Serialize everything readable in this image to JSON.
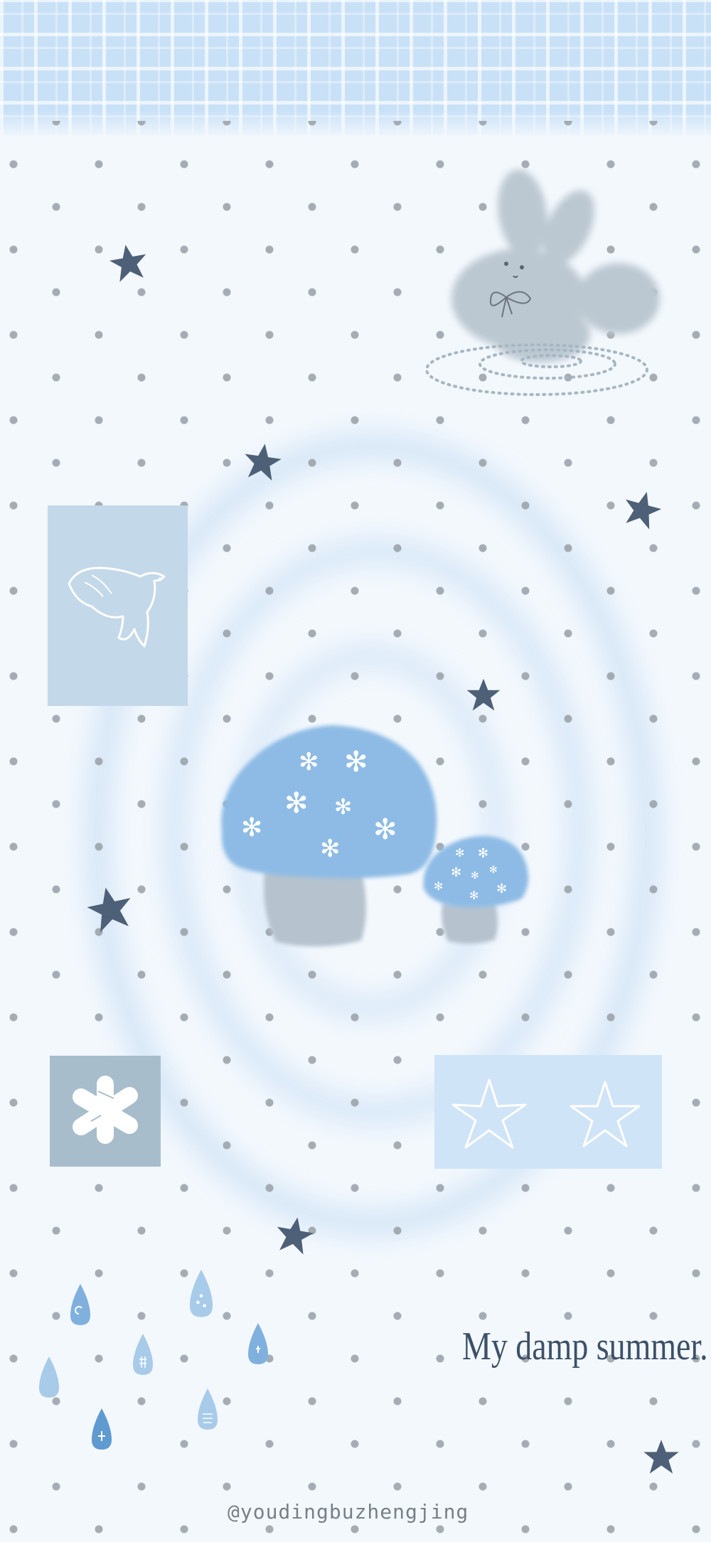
{
  "caption": "My damp summer.",
  "watermark": "@youdingbuzhengjing",
  "colors": {
    "background": "#f3f8fd",
    "plaid": "#c9e1f7",
    "polka_dot": "#9da4ab",
    "dark_star": "#4d6077",
    "mushroom_cap": "#8dbbe5",
    "mushroom_stem": "#b6c3cf",
    "bunny": "#bcc8d1",
    "panel_bird": "#c3d8e8",
    "panel_asterisk": "#a7bdcc",
    "panel_stars": "#d0e4f7",
    "raindrop": "#7fb0de",
    "text": "#3d5068"
  },
  "icons": [
    "bunny",
    "bird-outline",
    "asterisk",
    "star-outline",
    "mushroom",
    "raindrop",
    "star"
  ]
}
